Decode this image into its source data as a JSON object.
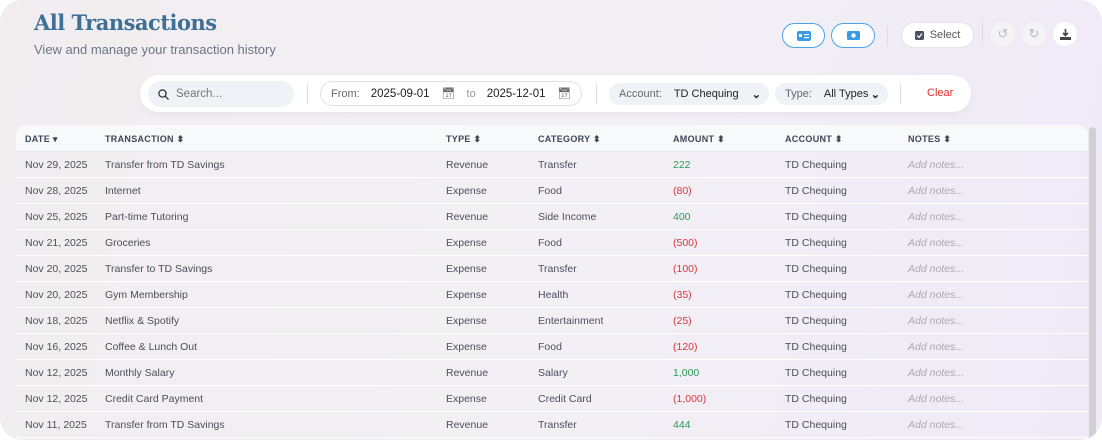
{
  "header": {
    "title": "All Transactions",
    "subtitle": "View and manage your transaction history",
    "select_label": "Select"
  },
  "filters": {
    "search_placeholder": "Search...",
    "from_label": "From:",
    "from": "2025-09-01",
    "to_label": "to",
    "to": "2025-12-01",
    "account_label": "Account:",
    "account": "TD Chequing",
    "type_label": "Type:",
    "type": "All Types",
    "clear": "Clear"
  },
  "columns": [
    "DATE",
    "TRANSACTION",
    "TYPE",
    "CATEGORY",
    "AMOUNT",
    "ACCOUNT",
    "NOTES"
  ],
  "rows": [
    [
      "Nov 29, 2025",
      "Transfer from TD Savings",
      "Revenue",
      "Transfer",
      "222",
      "TD Chequing",
      "Add notes..."
    ],
    [
      "Nov 28, 2025",
      "Internet",
      "Expense",
      "Food",
      "(80)",
      "TD Chequing",
      "Add notes..."
    ],
    [
      "Nov 25, 2025",
      "Part-time Tutoring",
      "Revenue",
      "Side Income",
      "400",
      "TD Chequing",
      "Add notes..."
    ],
    [
      "Nov 21, 2025",
      "Groceries",
      "Expense",
      "Food",
      "(500)",
      "TD Chequing",
      "Add notes..."
    ],
    [
      "Nov 20, 2025",
      "Transfer to TD Savings",
      "Expense",
      "Transfer",
      "(100)",
      "TD Chequing",
      "Add notes..."
    ],
    [
      "Nov 20, 2025",
      "Gym Membership",
      "Expense",
      "Health",
      "(35)",
      "TD Chequing",
      "Add notes..."
    ],
    [
      "Nov 18, 2025",
      "Netflix & Spotify",
      "Expense",
      "Entertainment",
      "(25)",
      "TD Chequing",
      "Add notes..."
    ],
    [
      "Nov 16, 2025",
      "Coffee & Lunch Out",
      "Expense",
      "Food",
      "(120)",
      "TD Chequing",
      "Add notes..."
    ],
    [
      "Nov 12, 2025",
      "Monthly Salary",
      "Revenue",
      "Salary",
      "1,000",
      "TD Chequing",
      "Add notes..."
    ],
    [
      "Nov 12, 2025",
      "Credit Card Payment",
      "Expense",
      "Credit Card",
      "(1,000)",
      "TD Chequing",
      "Add notes..."
    ],
    [
      "Nov 11, 2025",
      "Transfer from TD Savings",
      "Revenue",
      "Transfer",
      "444",
      "TD Chequing",
      "Add notes..."
    ]
  ]
}
